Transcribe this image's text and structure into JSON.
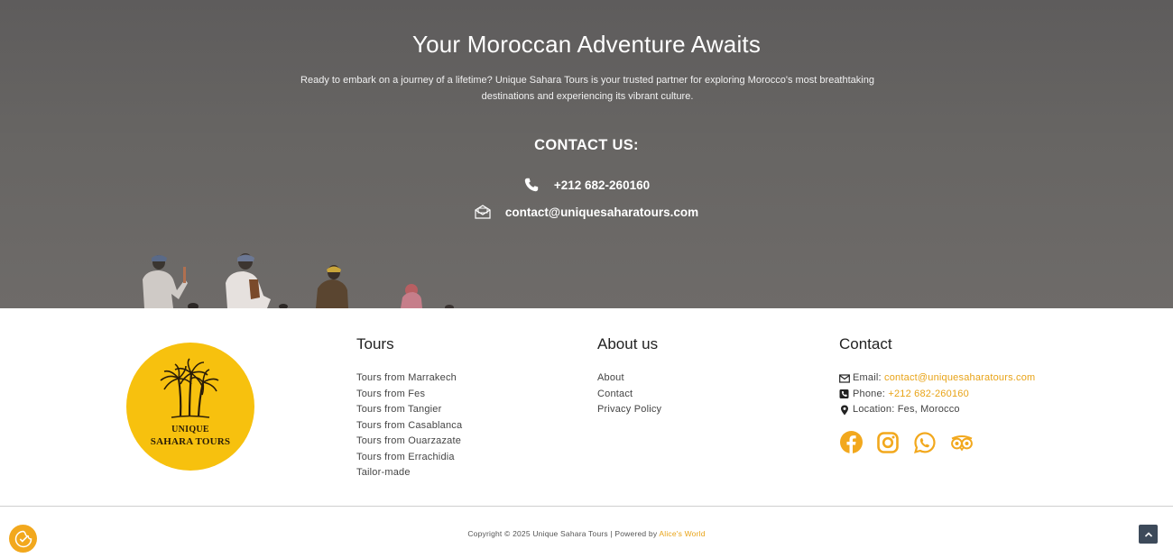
{
  "hero": {
    "title": "Your Moroccan Adventure Awaits",
    "text_line1": "Ready to embark on a journey of a lifetime? Unique Sahara Tours is your trusted partner for exploring Morocco's most breathtaking",
    "text_line2": "destinations and experiencing its vibrant culture.",
    "contact_heading": "CONTACT US:",
    "phone": "+212 682-260160",
    "email": "contact@uniquesaharatours.com"
  },
  "logo": {
    "line1": "UNIQUE",
    "line2": "SAHARA TOURS"
  },
  "tours": {
    "heading": "Tours",
    "items": [
      "Tours from Marrakech",
      "Tours from Fes",
      "Tours from Tangier",
      "Tours from Casablanca",
      "Tours from Ouarzazate",
      "Tours from Errachidia",
      "Tailor-made"
    ]
  },
  "about": {
    "heading": "About us",
    "items": [
      "About",
      "Contact",
      "Privacy Policy"
    ]
  },
  "contact": {
    "heading": "Contact",
    "email_label": "Email:",
    "email_value": "contact@uniquesaharatours.com",
    "phone_label": "Phone:",
    "phone_value": "+212 682-260160",
    "location_label": "Location:",
    "location_value": "Fes, Morocco",
    "socials": [
      "facebook-icon",
      "instagram-icon",
      "whatsapp-icon",
      "tripadvisor-icon"
    ]
  },
  "footer": {
    "copyright": "Copyright © 2025 Unique Sahara Tours | Powered by",
    "powered_by": "Alice's World"
  },
  "colors": {
    "accent": "#e8a317",
    "logo_bg": "#f7c10e",
    "hero_overlay": "#656361"
  }
}
